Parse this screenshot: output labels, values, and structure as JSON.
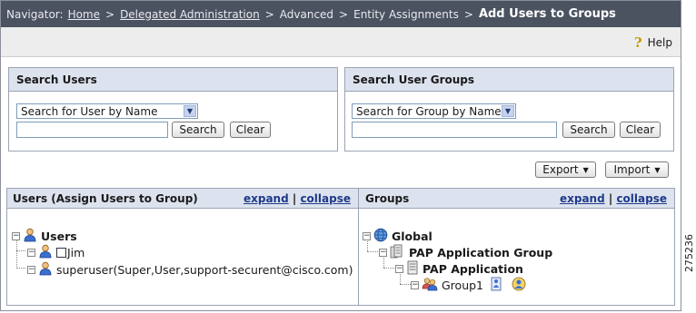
{
  "navigator": {
    "prefix": "Navigator:",
    "home": "Home",
    "delegated": "Delegated Administration",
    "advanced": "Advanced",
    "entity": "Entity Assignments",
    "current": "Add Users to Groups",
    "separator": ">"
  },
  "toolbar": {
    "help_label": "Help"
  },
  "search_users": {
    "title": "Search Users",
    "select_value": "Search for User by Name",
    "search_label": "Search",
    "clear_label": "Clear"
  },
  "search_groups": {
    "title": "Search User Groups",
    "select_value": "Search for Group by Name",
    "search_label": "Search",
    "clear_label": "Clear"
  },
  "actions": {
    "export_label": "Export",
    "import_label": "Import"
  },
  "users_panel": {
    "title": "Users (Assign Users to Group)",
    "expand": "expand",
    "divider": "|",
    "collapse": "collapse",
    "root": "Users",
    "user1": "Jim",
    "user2": "superuser(Super,User,support-securent@cisco.com)"
  },
  "groups_panel": {
    "title": "Groups",
    "expand": "expand",
    "divider": "|",
    "collapse": "collapse",
    "root": "Global",
    "app_group": "PAP Application Group",
    "app": "PAP Application",
    "group1": "Group1"
  },
  "figure_id": "275236"
}
